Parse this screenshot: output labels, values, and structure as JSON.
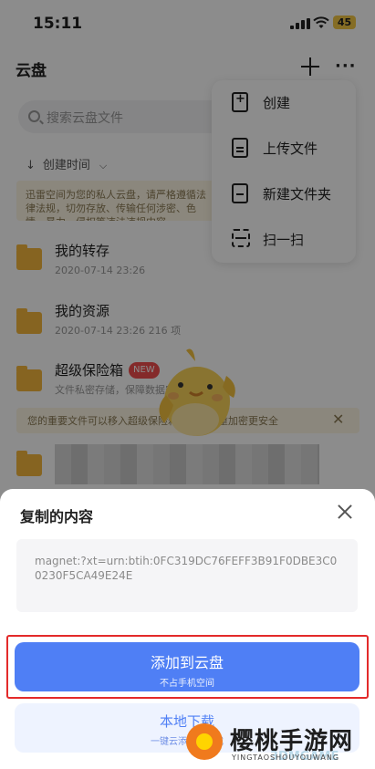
{
  "status_bar": {
    "time": "15:11",
    "battery": "45"
  },
  "header": {
    "title": "云盘"
  },
  "search": {
    "placeholder": "搜索云盘文件"
  },
  "sort": {
    "label": "创建时间"
  },
  "notice": {
    "text": "迅雷空间为您的私人云盘，请严格遵循法律法规，切勿存放、传输任何涉密、色情、暴力、侵权等违法违规内容。",
    "secure_tip": "您的重要文件可以移入超级保险箱保存，双重加密更安全"
  },
  "files": [
    {
      "name": "我的转存",
      "meta": "2020-07-14 23:26"
    },
    {
      "name": "我的资源",
      "meta": "2020-07-14 23:26  216 项"
    },
    {
      "name": "超级保险箱",
      "meta": "文件私密存储，保障数据安全",
      "badge": "NEW"
    }
  ],
  "menu": {
    "items": [
      {
        "label": "创建",
        "icon": "create-icon"
      },
      {
        "label": "上传文件",
        "icon": "upload-file-icon"
      },
      {
        "label": "新建文件夹",
        "icon": "new-folder-icon"
      },
      {
        "label": "扫一扫",
        "icon": "scan-icon"
      }
    ]
  },
  "sheet": {
    "title": "复制的内容",
    "content": "magnet:?xt=urn:btih:0FC319DC76FEFF3B91F0DBE3C00230F5CA49E24E",
    "primary_button": {
      "label": "添加到云盘",
      "sub": "不占手机空间"
    },
    "secondary_button": {
      "label": "本地下载",
      "sub": "一键云添加并下载"
    }
  },
  "watermark": {
    "title": "樱桃手游网",
    "sub": "YINGTAOSHOUYOUWANG",
    "tag": "3DMGAME"
  },
  "colors": {
    "accent": "#4f7ff5",
    "highlight": "#e32a2a",
    "folder": "#f4b73d",
    "notice_bg": "#fdf6e3"
  }
}
